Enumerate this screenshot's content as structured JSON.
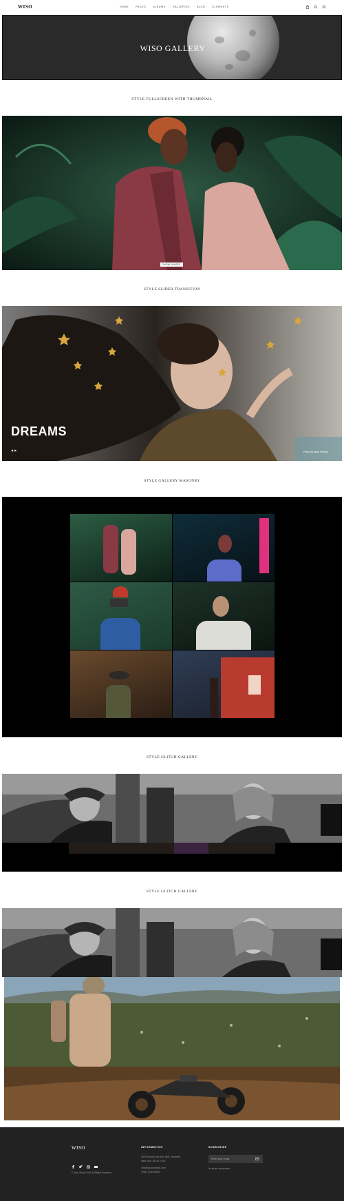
{
  "nav": {
    "logo": "WISO",
    "items": [
      "HOME",
      "PAGES",
      "ALBUMS",
      "GALLERIES",
      "BLOG",
      "ELEMENTS"
    ]
  },
  "hero": {
    "title": "WISO GALLERY"
  },
  "sections": {
    "s1": {
      "title": "STYLE FULLSCREEN WITH THUMBNAIL",
      "badge": "SHOW IMAGES"
    },
    "s2": {
      "title": "STYLE SLIDER TRANSITION",
      "caption": "DREAMS",
      "credit": "Photo by Alina Friends"
    },
    "s3": {
      "title": "STYLE GALLERY MASONRY"
    },
    "s4": {
      "title": "STYLE GLITCH GALLERY"
    },
    "s5": {
      "title": "STYLE GLITCH GALLERY"
    }
  },
  "footer": {
    "logo": "WISO",
    "copyright": "© Wiso Studio 2016. All Rights Reserved.",
    "info_title": "INFORMATION",
    "address_1": "2005 Stokes Isle Apt. 896, Venaville,",
    "address_2": "New York 10010, USA",
    "email": "info@yourdomain.com",
    "phone": "(+68) 120034509",
    "subscribe_title": "SUBSCRIBE",
    "email_placeholder": "Enter your email",
    "no_spam": "No spam, we promise."
  },
  "colors": {
    "footer_bg": "#222222",
    "masonry_bg": "#000000"
  }
}
